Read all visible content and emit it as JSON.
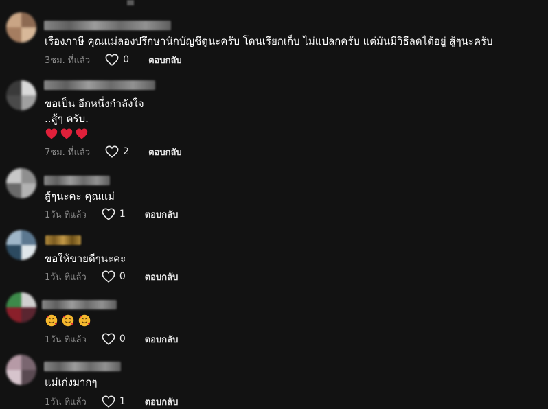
{
  "comments": [
    {
      "text": "เรื่องภาษี คุณแม่ลองปรึกษานักบัญชีดูนะครับ โดนเรียกเก็บ ไม่แปลกครับ แต่มันมีวิธีลดได้อยู่ สู้ๆนะครับ",
      "time": "3ชม. ที่แล้ว",
      "likes": "0",
      "reply": "ตอบกลับ"
    },
    {
      "text_lines": [
        "ขอเป็น อีกหนึ่งกำลังใจ",
        "..สู้ๆ ครับ."
      ],
      "emoji": [
        "heart",
        "heart",
        "heart"
      ],
      "time": "7ชม. ที่แล้ว",
      "likes": "2",
      "reply": "ตอบกลับ"
    },
    {
      "text": "สู้ๆนะคะ คุณแม่",
      "time": "1วัน ที่แล้ว",
      "likes": "1",
      "reply": "ตอบกลับ"
    },
    {
      "text": "ขอให้ขายดีๆนะคะ",
      "time": "1วัน ที่แล้ว",
      "likes": "0",
      "reply": "ตอบกลับ"
    },
    {
      "emoji": [
        "smiling-hearts",
        "smiling-hearts",
        "smiling-hearts"
      ],
      "time": "1วัน ที่แล้ว",
      "likes": "0",
      "reply": "ตอบกลับ"
    },
    {
      "text": "แม่เก่งมากๆ",
      "time": "1วัน ที่แล้ว",
      "likes": "1",
      "reply": "ตอบกลับ"
    }
  ],
  "icons": {
    "like": "heart-outline-icon",
    "heart_emoji": "red-heart-emoji",
    "smile_emoji": "smiling-face-with-hearts-emoji"
  },
  "colors": {
    "background": "#121212",
    "text": "#ffffff",
    "muted": "#8a8a8a",
    "heart_red": "#e0203a",
    "emoji_yellow": "#f5b82e"
  }
}
